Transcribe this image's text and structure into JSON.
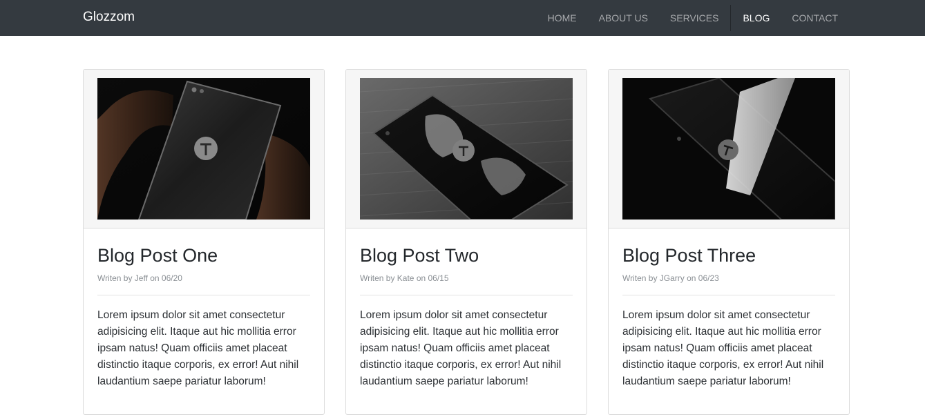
{
  "nav": {
    "brand": "Glozzom",
    "items": [
      {
        "label": "HOME"
      },
      {
        "label": "ABOUT US"
      },
      {
        "label": "SERVICES"
      },
      {
        "label": "BLOG"
      },
      {
        "label": "CONTACT"
      }
    ],
    "active": "BLOG"
  },
  "posts": [
    {
      "title": "Blog Post One",
      "meta": "Writen by Jeff on 06/20",
      "text": "Lorem ipsum dolor sit amet consectetur adipisicing elit. Itaque aut hic mollitia error ipsam natus! Quam officiis amet placeat distinctio itaque corporis, ex error! Aut nihil laudantium saepe pariatur laborum!"
    },
    {
      "title": "Blog Post Two",
      "meta": "Writen by Kate on 06/15",
      "text": "Lorem ipsum dolor sit amet consectetur adipisicing elit. Itaque aut hic mollitia error ipsam natus! Quam officiis amet placeat distinctio itaque corporis, ex error! Aut nihil laudantium saepe pariatur laborum!"
    },
    {
      "title": "Blog Post Three",
      "meta": "Writen by JGarry on 06/23",
      "text": "Lorem ipsum dolor sit amet consectetur adipisicing elit. Itaque aut hic mollitia error ipsam natus! Quam officiis amet placeat distinctio itaque corporis, ex error! Aut nihil laudantium saepe pariatur laborum!"
    }
  ],
  "colors": {
    "navbar": "#343a40",
    "nav_link": "#a7a9ac",
    "nav_active": "#ffffff",
    "card_border": "#dcdcdc",
    "card_header_bg": "#f6f6f6"
  }
}
